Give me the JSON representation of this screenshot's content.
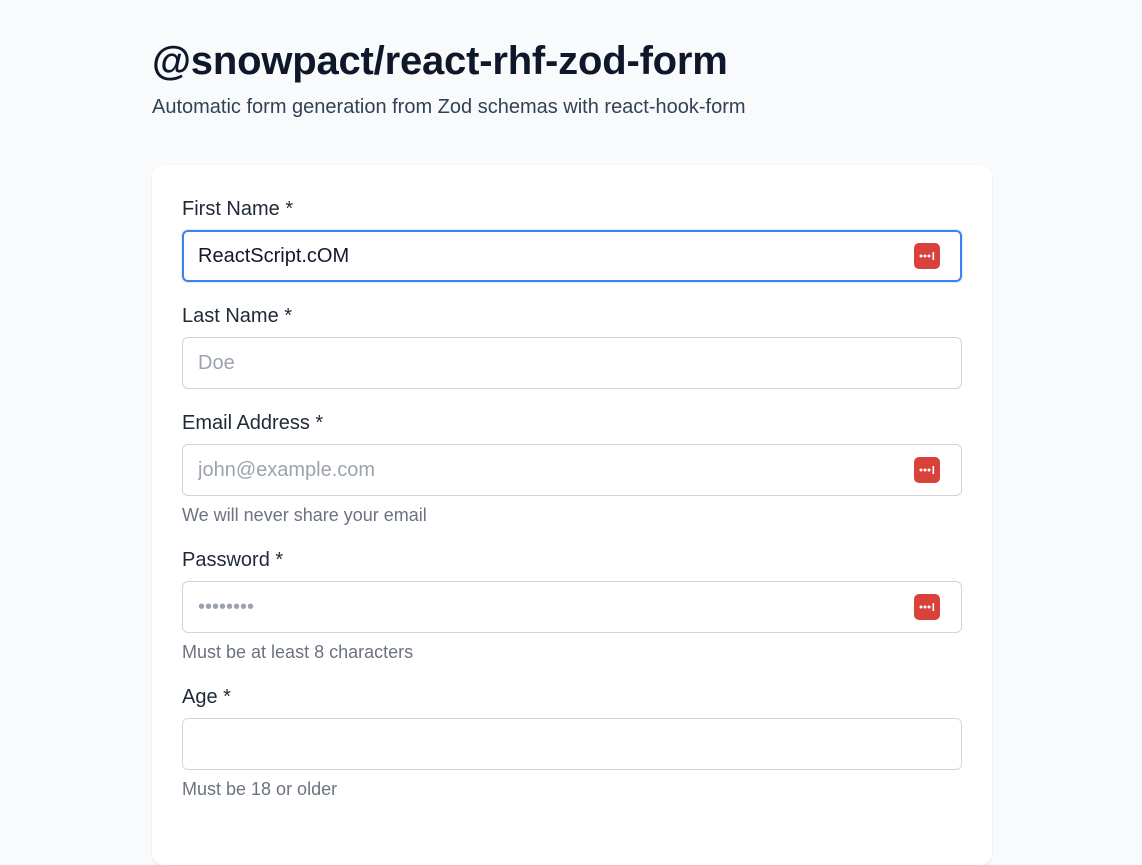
{
  "header": {
    "title": "@snowpact/react-rhf-zod-form",
    "subtitle": "Automatic form generation from Zod schemas with react-hook-form"
  },
  "form": {
    "fields": [
      {
        "label": "First Name *",
        "value": "ReactScript.cOM",
        "placeholder": "",
        "focused": true,
        "password_manager_icon": "password-manager-icon"
      },
      {
        "label": "Last Name *",
        "value": "",
        "placeholder": "Doe"
      },
      {
        "label": "Email Address *",
        "value": "",
        "placeholder": "john@example.com",
        "helper": "We will never share your email",
        "password_manager_icon": "password-manager-icon"
      },
      {
        "label": "Password *",
        "value": "",
        "placeholder": "••••••••",
        "helper": "Must be at least 8 characters",
        "password_manager_icon": "password-manager-icon"
      },
      {
        "label": "Age *",
        "value": "",
        "placeholder": "",
        "helper": "Must be 18 or older"
      }
    ]
  },
  "colors": {
    "background": "#f8fafc",
    "card": "#ffffff",
    "focus_border": "#3b82f6",
    "input_border": "#d1d5db",
    "password_icon": "#d9413b",
    "helper_text": "#6b7280"
  }
}
